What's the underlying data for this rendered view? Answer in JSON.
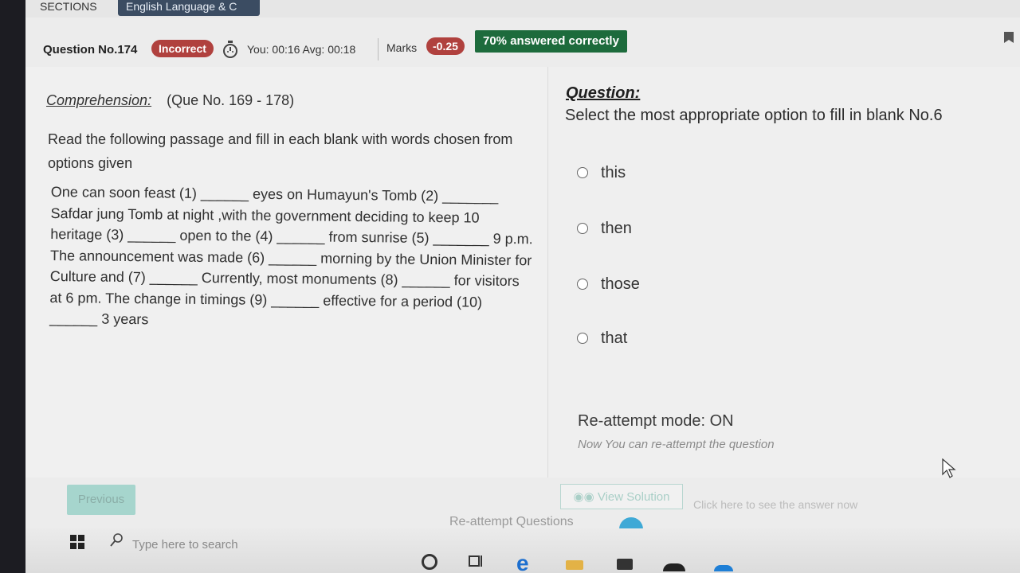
{
  "sections": {
    "label": "SECTIONS",
    "active_tab": "English Language & C"
  },
  "header": {
    "question_no": "Question No.174",
    "status_badge": "Incorrect",
    "timer": "You: 00:16  Avg: 00:18",
    "marks_label": "Marks",
    "marks_value": "-0.25",
    "answered_correctly": "70% answered correctly"
  },
  "comprehension": {
    "link": "Comprehension:",
    "range": "(Que No. 169 - 178)",
    "instructions": "Read the following passage and fill in each blank with words chosen from options given",
    "passage": "One can soon feast (1) ______ eyes on Humayun's Tomb (2) _______ Safdar jung Tomb at night ,with the government deciding to keep 10 heritage (3) ______ open to the (4) ______ from sunrise (5) _______ 9 p.m. The announcement was made (6) ______ morning by the Union Minister for Culture and (7) ______ Currently, most monuments (8) ______ for visitors at 6 pm. The change in timings (9) ______ effective for a period (10) ______ 3 years"
  },
  "question": {
    "heading": "Question:",
    "text": "Select the most appropriate option to fill in blank No.6",
    "options": [
      "this",
      "then",
      "those",
      "that"
    ]
  },
  "reattempt": {
    "title": "Re-attempt mode: ON",
    "subtitle": "Now You can re-attempt the question"
  },
  "footer": {
    "previous": "Previous",
    "view_solution": "View Solution",
    "view_hint": "Click here to see the answer now",
    "reattempt_questions": "Re-attempt Questions"
  },
  "taskbar": {
    "search_placeholder": "Type here to search"
  },
  "colors": {
    "incorrect": "#b0413e",
    "correct_badge": "#1d6b3c",
    "accent_teal": "#9ad2c8",
    "blue_dot": "#3fa9d6"
  }
}
